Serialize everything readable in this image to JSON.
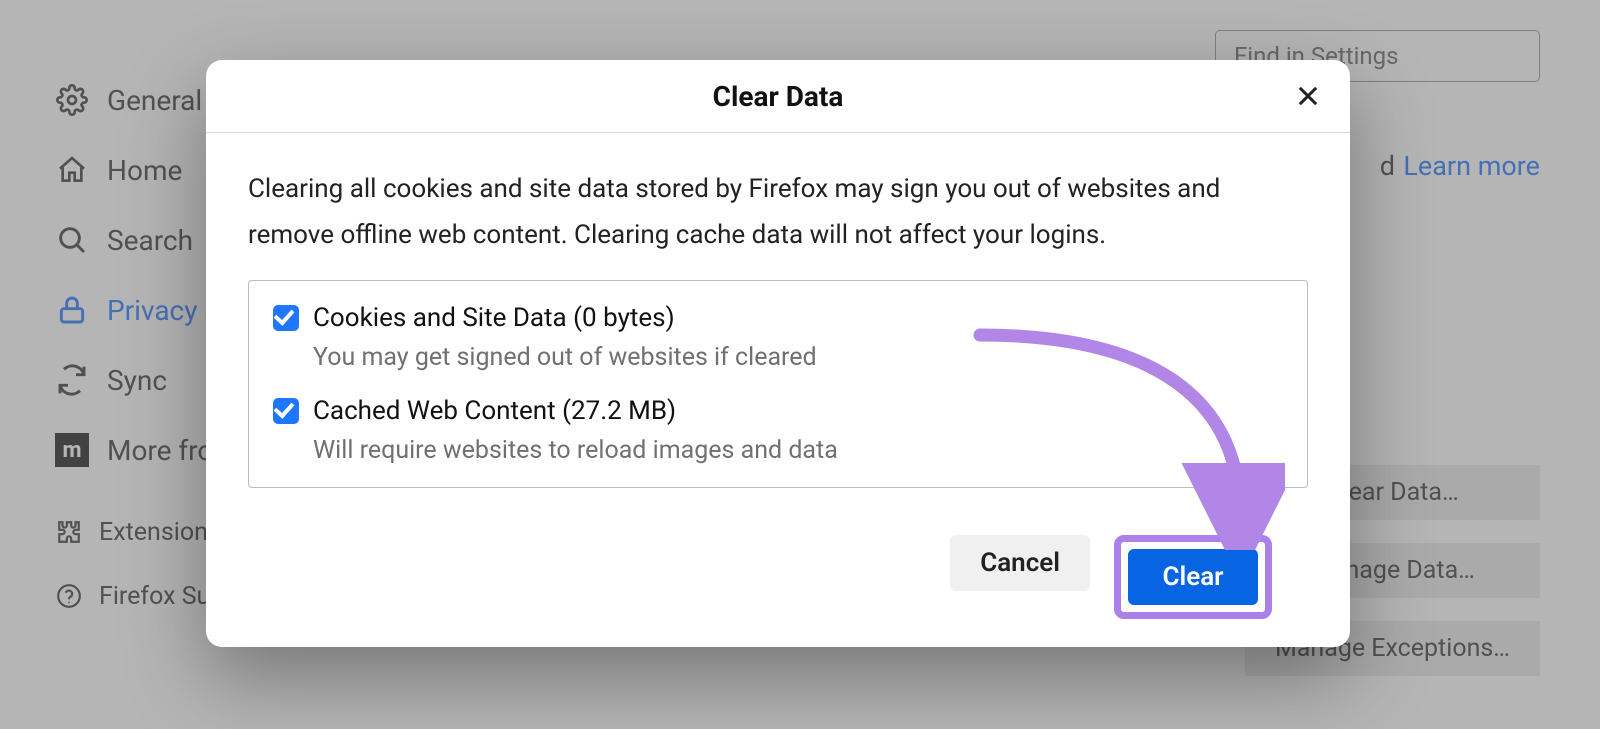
{
  "search": {
    "placeholder": "Find in Settings"
  },
  "learn_more": "Learn more",
  "partial_d": "d",
  "sidebar": {
    "items": [
      {
        "label": "General"
      },
      {
        "label": "Home"
      },
      {
        "label": "Search"
      },
      {
        "label": "Privacy & Security"
      },
      {
        "label": "Sync"
      },
      {
        "label": "More from Mozilla"
      },
      {
        "label": "Extensions & Themes"
      },
      {
        "label": "Firefox Support"
      }
    ]
  },
  "right_buttons": {
    "clear_data": "Clear Data…",
    "manage_data": "Manage Data…",
    "manage_exceptions": "Manage Exceptions…"
  },
  "dialog": {
    "title": "Clear Data",
    "description": "Clearing all cookies and site data stored by Firefox may sign you out of websites and remove offline web content. Clearing cache data will not affect your logins.",
    "options": [
      {
        "label": "Cookies and Site Data (0 bytes)",
        "sub": "You may get signed out of websites if cleared",
        "checked": true
      },
      {
        "label": "Cached Web Content (27.2 MB)",
        "sub": "Will require websites to reload images and data",
        "checked": true
      }
    ],
    "cancel_label": "Cancel",
    "clear_label": "Clear"
  },
  "annotation": {
    "arrow_color": "#b186e6"
  }
}
